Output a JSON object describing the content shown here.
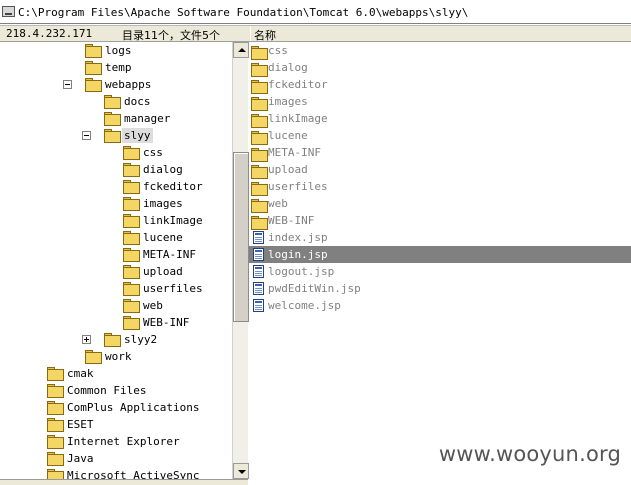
{
  "path_bar": {
    "path": "C:\\Program Files\\Apache Software Foundation\\Tomcat 6.0\\webapps\\slyy\\"
  },
  "status_bar": {
    "ip": "218.4.232.171",
    "summary": "目录11个，文件5个",
    "column_name": "名称"
  },
  "tree": [
    {
      "label": "logs",
      "indent": 2,
      "expander": "none"
    },
    {
      "label": "temp",
      "indent": 2,
      "expander": "none"
    },
    {
      "label": "webapps",
      "indent": 2,
      "expander": "minus"
    },
    {
      "label": "docs",
      "indent": 3,
      "expander": "none"
    },
    {
      "label": "manager",
      "indent": 3,
      "expander": "none"
    },
    {
      "label": "slyy",
      "indent": 3,
      "expander": "minus",
      "selected": true
    },
    {
      "label": "css",
      "indent": 4,
      "expander": "none"
    },
    {
      "label": "dialog",
      "indent": 4,
      "expander": "none"
    },
    {
      "label": "fckeditor",
      "indent": 4,
      "expander": "none"
    },
    {
      "label": "images",
      "indent": 4,
      "expander": "none"
    },
    {
      "label": "linkImage",
      "indent": 4,
      "expander": "none"
    },
    {
      "label": "lucene",
      "indent": 4,
      "expander": "none"
    },
    {
      "label": "META-INF",
      "indent": 4,
      "expander": "none"
    },
    {
      "label": "upload",
      "indent": 4,
      "expander": "none"
    },
    {
      "label": "userfiles",
      "indent": 4,
      "expander": "none"
    },
    {
      "label": "web",
      "indent": 4,
      "expander": "none"
    },
    {
      "label": "WEB-INF",
      "indent": 4,
      "expander": "none"
    },
    {
      "label": "slyy2",
      "indent": 3,
      "expander": "plus"
    },
    {
      "label": "work",
      "indent": 2,
      "expander": "none"
    },
    {
      "label": "cmak",
      "indent": 0,
      "expander": "none"
    },
    {
      "label": "Common Files",
      "indent": 0,
      "expander": "none"
    },
    {
      "label": "ComPlus Applications",
      "indent": 0,
      "expander": "none"
    },
    {
      "label": "ESET",
      "indent": 0,
      "expander": "none"
    },
    {
      "label": "Internet Explorer",
      "indent": 0,
      "expander": "none"
    },
    {
      "label": "Java",
      "indent": 0,
      "expander": "none"
    },
    {
      "label": "Microsoft ActiveSync",
      "indent": 0,
      "expander": "none"
    }
  ],
  "files": [
    {
      "name": "css",
      "type": "folder"
    },
    {
      "name": "dialog",
      "type": "folder"
    },
    {
      "name": "fckeditor",
      "type": "folder"
    },
    {
      "name": "images",
      "type": "folder"
    },
    {
      "name": "linkImage",
      "type": "folder"
    },
    {
      "name": "lucene",
      "type": "folder"
    },
    {
      "name": "META-INF",
      "type": "folder"
    },
    {
      "name": "upload",
      "type": "folder"
    },
    {
      "name": "userfiles",
      "type": "folder"
    },
    {
      "name": "web",
      "type": "folder"
    },
    {
      "name": "WEB-INF",
      "type": "folder"
    },
    {
      "name": "index.jsp",
      "type": "file"
    },
    {
      "name": "login.jsp",
      "type": "file",
      "selected": true
    },
    {
      "name": "logout.jsp",
      "type": "file"
    },
    {
      "name": "pwdEditWin.jsp",
      "type": "file"
    },
    {
      "name": "welcome.jsp",
      "type": "file"
    }
  ],
  "watermark": "www.wooyun.org",
  "colors": {
    "folder_fill": "#f4d664",
    "selection": "#808080",
    "file_text": "#808080"
  }
}
